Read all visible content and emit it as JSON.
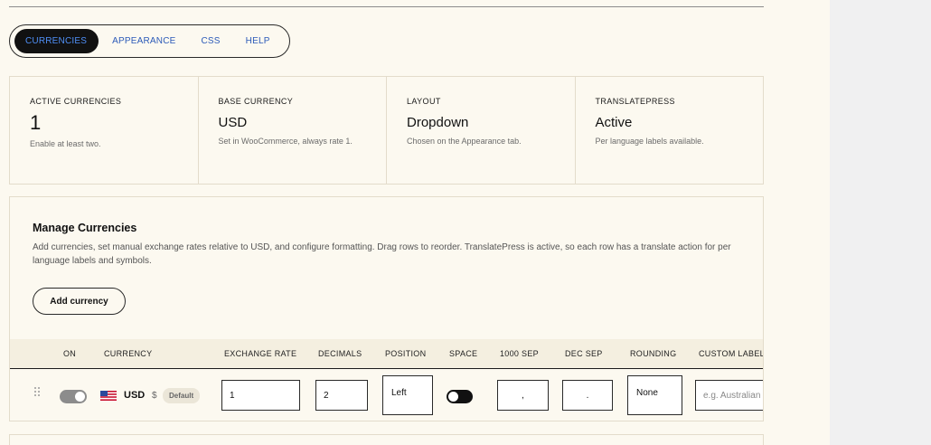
{
  "tabs": {
    "currencies": "CURRENCIES",
    "appearance": "APPEARANCE",
    "css": "CSS",
    "help": "HELP"
  },
  "stats": [
    {
      "label": "ACTIVE CURRENCIES",
      "value": "1",
      "note": "Enable at least two."
    },
    {
      "label": "BASE CURRENCY",
      "value": "USD",
      "note": "Set in WooCommerce, always rate 1."
    },
    {
      "label": "LAYOUT",
      "value": "Dropdown",
      "note": "Chosen on the Appearance tab."
    },
    {
      "label": "TRANSLATEPRESS",
      "value": "Active",
      "note": "Per language labels available."
    }
  ],
  "manage": {
    "title": "Manage Currencies",
    "description": "Add currencies, set manual exchange rates relative to USD, and configure formatting. Drag rows to reorder. TranslatePress is active, so each row has a translate action for per language labels and symbols.",
    "add_button": "Add currency"
  },
  "table": {
    "headers": {
      "on": "ON",
      "currency": "CURRENCY",
      "rate": "EXCHANGE RATE",
      "decimals": "DECIMALS",
      "position": "POSITION",
      "space": "SPACE",
      "thousand": "1000 SEP",
      "decimal_sep": "DEC SEP",
      "rounding": "ROUNDING",
      "custom_label": "CUSTOM LABEL"
    },
    "row": {
      "enabled": true,
      "code": "USD",
      "symbol": "$",
      "badge": "Default",
      "rate": "1",
      "decimals": "2",
      "position": "Left",
      "space": true,
      "thousand_sep": ",",
      "decimal_sep": ".",
      "rounding": "None",
      "custom_label_placeholder": "e.g. Australian"
    }
  },
  "icons": {
    "drag": "drag-handle-icon",
    "flag": "us-flag-icon"
  },
  "colors": {
    "background": "#fcf9f0",
    "active_tab_bg": "#111111",
    "active_tab_text": "#4f8ff7",
    "tab_link": "#2b5ab8",
    "border": "#e3dccb"
  }
}
